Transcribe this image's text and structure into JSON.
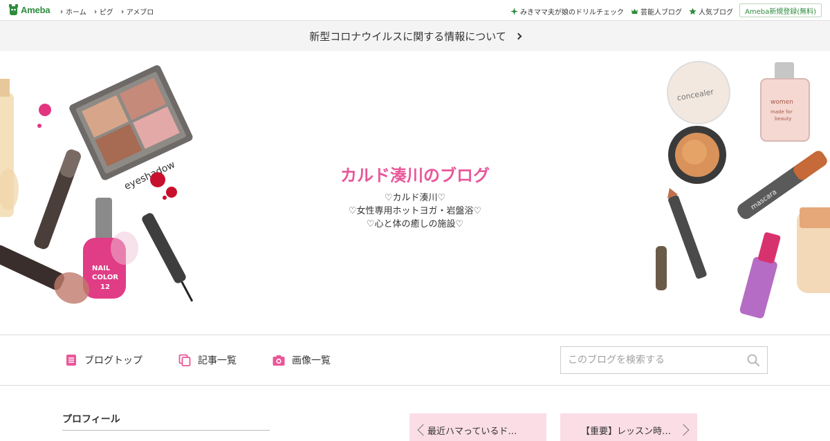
{
  "topbar": {
    "logo_text": "Ameba",
    "nav": [
      "ホーム",
      "ピグ",
      "アメブロ"
    ],
    "right_links": [
      {
        "label": "みきママ夫が娘のドリルチェック",
        "icon": "sparkle-icon"
      },
      {
        "label": "芸能人ブログ",
        "icon": "crown-icon"
      },
      {
        "label": "人気ブログ",
        "icon": "star-icon"
      }
    ],
    "register_label": "Ameba新規登録(無料)",
    "accent_color": "#2d8c3c"
  },
  "notice": {
    "text": "新型コロナウイルスに関する情報について"
  },
  "header": {
    "title": "カルド湊川のブログ",
    "desc_lines": [
      "♡カルド湊川♡",
      "♡女性専用ホットヨガ・岩盤浴♡",
      "♡心と体の癒しの施設♡"
    ],
    "title_color": "#e9579a",
    "deco_texts": {
      "eyeshadow": "eyeshadow",
      "nail1": "NAIL",
      "nail2": "COLOR",
      "nail3": "12",
      "perfume1": "women",
      "perfume2": "made for",
      "perfume3": "beauty",
      "compact": "concealer",
      "mascara": "mascara"
    }
  },
  "blognav": {
    "items": [
      {
        "label": "ブログトップ",
        "icon": "document-icon"
      },
      {
        "label": "記事一覧",
        "icon": "copy-icon"
      },
      {
        "label": "画像一覧",
        "icon": "camera-icon"
      }
    ],
    "search_placeholder": "このブログを検索する",
    "icon_color": "#e9579a"
  },
  "content": {
    "profile_title": "プロフィール",
    "prev_post": "最近ハマっているド…",
    "next_post": "【重要】レッスン時…"
  }
}
